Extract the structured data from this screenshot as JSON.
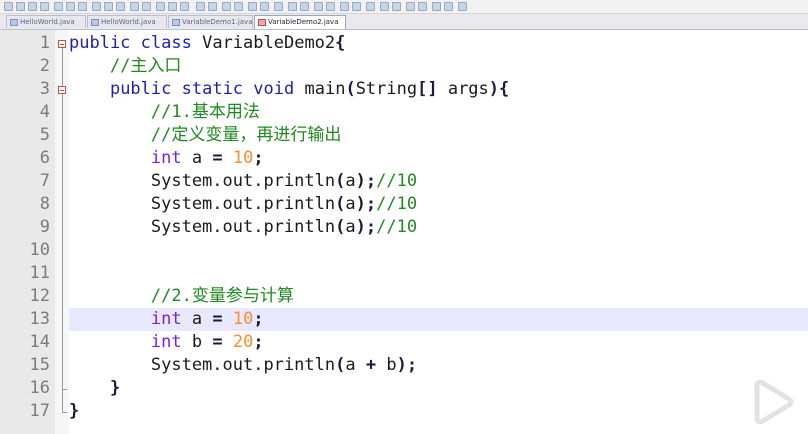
{
  "tabs": [
    {
      "label": "HelloWorld.java",
      "active": false
    },
    {
      "label": "HelloWorld.java",
      "active": false
    },
    {
      "label": "VariableDemo1.java",
      "active": false
    },
    {
      "label": "VariableDemo2.java",
      "active": true
    }
  ],
  "editor": {
    "current_line": 13,
    "lines": [
      {
        "num": "1",
        "tokens": [
          [
            "kw",
            "public"
          ],
          [
            "t",
            " "
          ],
          [
            "kw",
            "class"
          ],
          [
            "t",
            " VariableDemo2"
          ],
          [
            "pn",
            "{"
          ]
        ]
      },
      {
        "num": "2",
        "tokens": [
          [
            "t",
            "    "
          ],
          [
            "cm",
            "//主入口"
          ]
        ]
      },
      {
        "num": "3",
        "tokens": [
          [
            "t",
            "    "
          ],
          [
            "kw",
            "public"
          ],
          [
            "t",
            " "
          ],
          [
            "kw",
            "static"
          ],
          [
            "t",
            " "
          ],
          [
            "kw",
            "void"
          ],
          [
            "t",
            " main"
          ],
          [
            "pn",
            "("
          ],
          [
            "t",
            "String"
          ],
          [
            "pn",
            "[]"
          ],
          [
            "t",
            " args"
          ],
          [
            "pn",
            ")"
          ],
          [
            "pn",
            "{"
          ]
        ]
      },
      {
        "num": "4",
        "tokens": [
          [
            "t",
            "        "
          ],
          [
            "cm",
            "//1.基本用法"
          ]
        ]
      },
      {
        "num": "5",
        "tokens": [
          [
            "t",
            "        "
          ],
          [
            "cm",
            "//定义变量，再进行输出"
          ]
        ]
      },
      {
        "num": "6",
        "tokens": [
          [
            "t",
            "        "
          ],
          [
            "ty",
            "int"
          ],
          [
            "t",
            " a "
          ],
          [
            "pn",
            "="
          ],
          [
            "t",
            " "
          ],
          [
            "num",
            "10"
          ],
          [
            "pn",
            ";"
          ]
        ]
      },
      {
        "num": "7",
        "tokens": [
          [
            "t",
            "        System.out.println"
          ],
          [
            "pn",
            "("
          ],
          [
            "t",
            "a"
          ],
          [
            "pn",
            ")"
          ],
          [
            "pn",
            ";"
          ],
          [
            "cm",
            "//10"
          ]
        ]
      },
      {
        "num": "8",
        "tokens": [
          [
            "t",
            "        System.out.println"
          ],
          [
            "pn",
            "("
          ],
          [
            "t",
            "a"
          ],
          [
            "pn",
            ")"
          ],
          [
            "pn",
            ";"
          ],
          [
            "cm",
            "//10"
          ]
        ]
      },
      {
        "num": "9",
        "tokens": [
          [
            "t",
            "        System.out.println"
          ],
          [
            "pn",
            "("
          ],
          [
            "t",
            "a"
          ],
          [
            "pn",
            ")"
          ],
          [
            "pn",
            ";"
          ],
          [
            "cm",
            "//10"
          ]
        ]
      },
      {
        "num": "10",
        "tokens": []
      },
      {
        "num": "11",
        "tokens": []
      },
      {
        "num": "12",
        "tokens": [
          [
            "t",
            "        "
          ],
          [
            "cm",
            "//2.变量参与计算"
          ]
        ]
      },
      {
        "num": "13",
        "tokens": [
          [
            "t",
            "        "
          ],
          [
            "ty",
            "int"
          ],
          [
            "t",
            " a "
          ],
          [
            "pn",
            "="
          ],
          [
            "t",
            " "
          ],
          [
            "num",
            "10"
          ],
          [
            "pn",
            ";"
          ]
        ]
      },
      {
        "num": "14",
        "tokens": [
          [
            "t",
            "        "
          ],
          [
            "ty",
            "int"
          ],
          [
            "t",
            " b "
          ],
          [
            "pn",
            "="
          ],
          [
            "t",
            " "
          ],
          [
            "num",
            "20"
          ],
          [
            "pn",
            ";"
          ]
        ]
      },
      {
        "num": "15",
        "tokens": [
          [
            "t",
            "        System.out.println"
          ],
          [
            "pn",
            "("
          ],
          [
            "t",
            "a "
          ],
          [
            "pn",
            "+"
          ],
          [
            "t",
            " b"
          ],
          [
            "pn",
            ")"
          ],
          [
            "pn",
            ";"
          ]
        ]
      },
      {
        "num": "16",
        "tokens": [
          [
            "t",
            "    "
          ],
          [
            "pn",
            "}"
          ]
        ]
      },
      {
        "num": "17",
        "tokens": [
          [
            "pn",
            "}"
          ]
        ]
      }
    ]
  },
  "colors": {
    "keyword": "#1d1dbf",
    "type": "#7a1ee0",
    "comment": "#1f8a1f",
    "number": "#ff8c2e",
    "current_line": "#e8e8ff"
  },
  "overlay": {
    "icon": "play-icon"
  }
}
